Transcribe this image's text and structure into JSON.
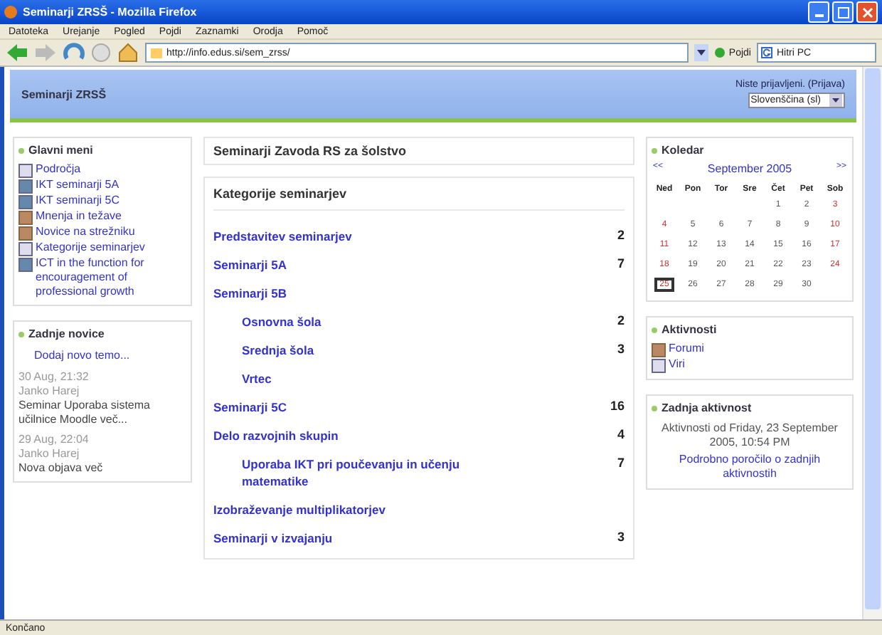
{
  "window": {
    "title": "Seminarji ZRSŠ - Mozilla Firefox"
  },
  "menu": [
    "Datoteka",
    "Urejanje",
    "Pogled",
    "Pojdi",
    "Zaznamki",
    "Orodja",
    "Pomoč"
  ],
  "toolbar": {
    "address": "http://info.edus.si/sem_zrss/",
    "go": "Pojdi",
    "search": "Hitri PC"
  },
  "header": {
    "site": "Seminarji ZRSŠ",
    "login": "Niste prijavljeni. (Prijava)",
    "language": "Slovenščina (sl)"
  },
  "main_menu": {
    "title": "Glavni meni",
    "items": [
      {
        "label": "Področja",
        "kind": "page"
      },
      {
        "label": "IKT seminarji 5A",
        "kind": "doc"
      },
      {
        "label": "IKT seminarji 5C",
        "kind": "doc"
      },
      {
        "label": "Mnenja in težave",
        "kind": "forum"
      },
      {
        "label": "Novice na strežniku",
        "kind": "forum"
      },
      {
        "label": "Kategorije seminarjev",
        "kind": "page"
      },
      {
        "label": "ICT in the function for encouragement of professional growth",
        "kind": "doc"
      }
    ]
  },
  "news": {
    "title": "Zadnje novice",
    "add": "Dodaj novo temo...",
    "posts": [
      {
        "date": "30 Aug, 21:32",
        "author": "Janko Harej",
        "text": "Seminar Uporaba sistema učilnice Moodle več..."
      },
      {
        "date": "29 Aug, 22:04",
        "author": "Janko Harej",
        "text": "Nova objava več"
      }
    ]
  },
  "center": {
    "title": "Seminarji Zavoda RS za šolstvo",
    "categories_title": "Kategorije seminarjev",
    "categories": [
      {
        "name": "Predstavitev seminarjev",
        "count": "2"
      },
      {
        "name": "Seminarji 5A",
        "count": "7"
      },
      {
        "name": "Seminarji 5B",
        "children": [
          {
            "name": "Osnovna šola",
            "count": "2"
          },
          {
            "name": "Srednja šola",
            "count": "3"
          },
          {
            "name": "Vrtec"
          }
        ]
      },
      {
        "name": "Seminarji 5C",
        "count": "16"
      },
      {
        "name": "Delo razvojnih skupin",
        "count": "4",
        "children": [
          {
            "name": "Uporaba IKT pri poučevanju in učenju matematike",
            "count": "7"
          }
        ]
      },
      {
        "name": "Izobraževanje multiplikatorjev"
      },
      {
        "name": "Seminarji v izvajanju",
        "count": "3"
      }
    ]
  },
  "calendar": {
    "title": "Koledar",
    "prev": "<<",
    "month": "September 2005",
    "next": ">>",
    "weekdays": [
      "Ned",
      "Pon",
      "Tor",
      "Sre",
      "Čet",
      "Pet",
      "Sob"
    ],
    "weeks": [
      [
        {
          "d": "1",
          "today": false
        },
        {
          "d": "2",
          "today": false
        },
        {
          "d": "3",
          "today": false
        }
      ],
      [
        {
          "d": "4",
          "today": false
        },
        {
          "d": "5",
          "today": false
        },
        {
          "d": "6",
          "today": false
        },
        {
          "d": "7",
          "today": false
        },
        {
          "d": "8",
          "today": false
        },
        {
          "d": "9",
          "today": false
        },
        {
          "d": "10",
          "today": false
        }
      ],
      [
        {
          "d": "11",
          "today": false
        },
        {
          "d": "12",
          "today": false
        },
        {
          "d": "13",
          "today": false
        },
        {
          "d": "14",
          "today": false
        },
        {
          "d": "15",
          "today": false
        },
        {
          "d": "16",
          "today": false
        },
        {
          "d": "17",
          "today": false
        }
      ],
      [
        {
          "d": "18",
          "today": false
        },
        {
          "d": "19",
          "today": false
        },
        {
          "d": "20",
          "today": false
        },
        {
          "d": "21",
          "today": false
        },
        {
          "d": "22",
          "today": false
        },
        {
          "d": "23",
          "today": false
        },
        {
          "d": "24",
          "today": false
        }
      ],
      [
        {
          "d": "25",
          "today": true
        },
        {
          "d": "26",
          "today": false
        },
        {
          "d": "27",
          "today": false
        },
        {
          "d": "28",
          "today": false
        },
        {
          "d": "29",
          "today": false
        },
        {
          "d": "30",
          "today": false
        }
      ]
    ]
  },
  "activities": {
    "title": "Aktivnosti",
    "items": [
      {
        "label": "Forumi",
        "kind": "forum"
      },
      {
        "label": "Viri",
        "kind": "page"
      }
    ]
  },
  "recent": {
    "title": "Zadnja aktivnost",
    "text": "Aktivnosti od Friday, 23 September 2005, 10:54 PM",
    "link": "Podrobno poročilo o zadnjih aktivnostih"
  },
  "status_bar": "Končano"
}
